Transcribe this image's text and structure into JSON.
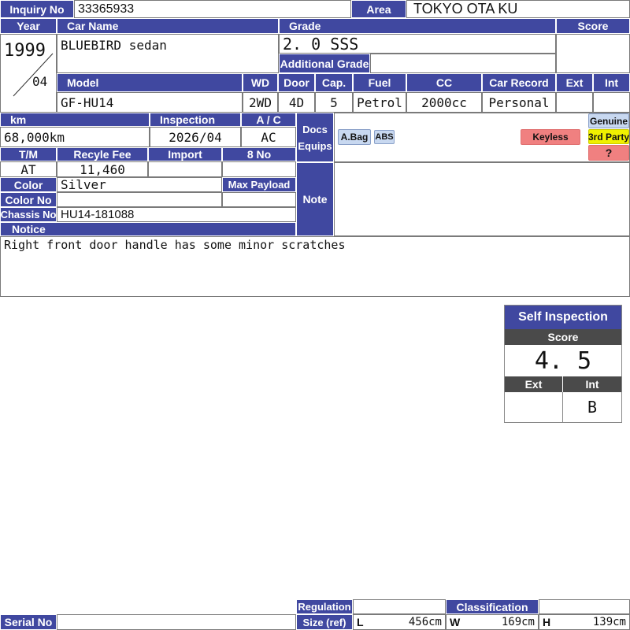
{
  "inquiry": {
    "label": "Inquiry No",
    "value": "33365933"
  },
  "area": {
    "label": "Area",
    "value": "TOKYO OTA KU"
  },
  "year": {
    "label": "Year",
    "value": "1999",
    "month": "04"
  },
  "car_name": {
    "label": "Car Name",
    "value": "BLUEBIRD sedan"
  },
  "grade": {
    "label": "Grade",
    "value": "2. 0  SSS",
    "additional_label": "Additional Grade",
    "additional_value": ""
  },
  "score": {
    "label": "Score",
    "value": ""
  },
  "model": {
    "label": "Model",
    "value": "GF-HU14"
  },
  "wd": {
    "label": "WD",
    "value": "2WD"
  },
  "door": {
    "label": "Door",
    "value": "4D"
  },
  "cap": {
    "label": "Cap.",
    "value": "5"
  },
  "fuel": {
    "label": "Fuel",
    "value": "Petrol"
  },
  "cc": {
    "label": "CC",
    "value": "2000cc"
  },
  "car_record": {
    "label": "Car Record",
    "value": "Personal"
  },
  "ext": {
    "label": "Ext",
    "value": ""
  },
  "int": {
    "label": "Int",
    "value": ""
  },
  "km": {
    "label": "km",
    "value": "68,000km"
  },
  "inspection": {
    "label": "Inspection",
    "value": "2026/04"
  },
  "ac": {
    "label": "A / C",
    "value": "AC"
  },
  "docs_equips": {
    "label": "Docs\nEquips",
    "docs": "Docs",
    "equips": "Equips"
  },
  "equipment_tags": {
    "airbag": "A.Bag",
    "abs": "ABS",
    "keyless": "Keyless"
  },
  "nav_tags": {
    "genuine": "Genuine",
    "third_party": "3rd Party",
    "unknown": "?"
  },
  "tm": {
    "label": "T/M",
    "value": "AT"
  },
  "recycle_fee": {
    "label": "Recyle Fee",
    "value": "11,460"
  },
  "import": {
    "label": "Import",
    "value": ""
  },
  "eight_no": {
    "label": "8 No",
    "value": ""
  },
  "color": {
    "label": "Color",
    "value": "Silver"
  },
  "max_payload": {
    "label": "Max Payload",
    "value": ""
  },
  "color_no": {
    "label": "Color No",
    "value": ""
  },
  "chassis_no": {
    "label": "Chassis No",
    "value": "HU14-181088"
  },
  "note": {
    "label": "Note"
  },
  "notice": {
    "label": "Notice",
    "text": "Right front door handle has some minor scratches"
  },
  "self_inspection": {
    "title": "Self Inspection",
    "score_label": "Score",
    "score_value": "4. 5",
    "ext_label": "Ext",
    "ext_value": "",
    "int_label": "Int",
    "int_value": "B"
  },
  "serial_no": {
    "label": "Serial No",
    "value": ""
  },
  "regulation": {
    "label": "Regulation",
    "value": ""
  },
  "classification": {
    "label": "Classification",
    "value": ""
  },
  "size": {
    "label": "Size (ref)",
    "l_label": "L",
    "l_value": "456cm",
    "w_label": "W",
    "w_value": "169cm",
    "h_label": "H",
    "h_value": "139cm"
  },
  "colors": {
    "header": "#4048a0",
    "keyless": "#f08080",
    "third_party": "#f0f000",
    "genuine": "#c8d8f0"
  }
}
